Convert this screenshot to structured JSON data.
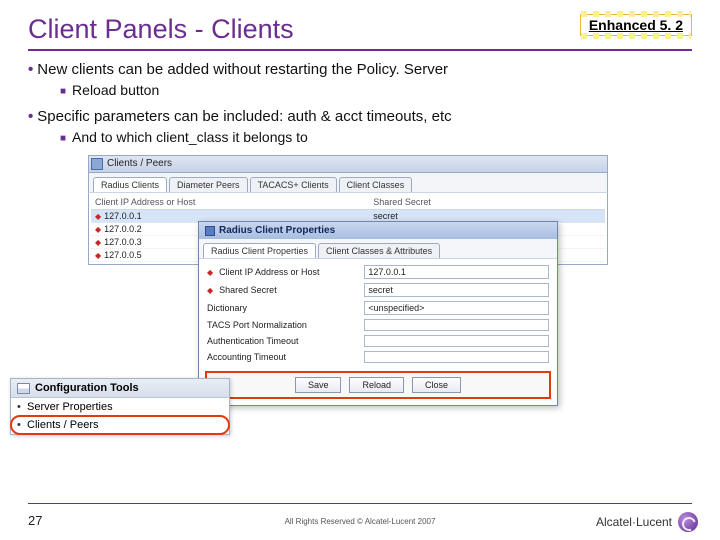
{
  "header": {
    "title": "Client Panels - Clients",
    "badge": "Enhanced 5. 2"
  },
  "bullets": {
    "b1a": "New clients can be added without restarting the Policy. Server",
    "b1a_sub": "Reload button",
    "b1b": "Specific parameters can be included: auth & acct timeouts, etc",
    "b1b_sub": "And to which client_class it belongs to"
  },
  "clients_window": {
    "title": "Clients / Peers",
    "tabs": [
      "Radius Clients",
      "Diameter Peers",
      "TACACS+ Clients",
      "Client Classes"
    ],
    "columns": {
      "c1": "Client IP Address or Host",
      "c2": "Shared Secret"
    },
    "rows": [
      {
        "ip": "127.0.0.1",
        "secret": "secret",
        "selected": true
      },
      {
        "ip": "127.0.0.2",
        "secret": "",
        "selected": false
      },
      {
        "ip": "127.0.0.3",
        "secret": "",
        "selected": false
      },
      {
        "ip": "127.0.0.5",
        "secret": "",
        "selected": false
      }
    ]
  },
  "dialog": {
    "title": "Radius Client Properties",
    "tabs": [
      "Radius Client Properties",
      "Client Classes & Attributes"
    ],
    "fields": [
      {
        "label": "Client IP Address or Host",
        "value": "127.0.0.1",
        "marker": true
      },
      {
        "label": "Shared Secret",
        "value": "secret",
        "marker": true
      },
      {
        "label": "Dictionary",
        "value": "<unspecified>",
        "marker": false
      },
      {
        "label": "TACS Port Normalization",
        "value": "",
        "marker": false
      },
      {
        "label": "Authentication Timeout",
        "value": "",
        "marker": false
      },
      {
        "label": "Accounting Timeout",
        "value": "",
        "marker": false
      }
    ],
    "buttons": {
      "save": "Save",
      "reload": "Reload",
      "close": "Close"
    }
  },
  "config_tools": {
    "title": "Configuration Tools",
    "items": [
      "Server Properties",
      "Clients / Peers"
    ]
  },
  "footer": {
    "page": "27",
    "copyright": "All Rights Reserved © Alcatel-Lucent 2007",
    "logo_text": "Alcatel·Lucent"
  }
}
